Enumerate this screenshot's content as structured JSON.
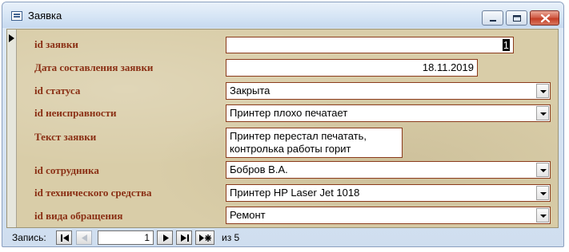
{
  "window": {
    "title": "Заявка"
  },
  "form": {
    "fields": [
      {
        "label": "id заявки",
        "value": "1"
      },
      {
        "label": "Дата составления заявки",
        "value": "18.11.2019"
      },
      {
        "label": "id статуса",
        "value": "Закрыта"
      },
      {
        "label": "id неисправности",
        "value": "Принтер плохо печатает"
      },
      {
        "label": "Текст заявки",
        "value": "Принтер перестал печатать,\nконтролька работы горит"
      },
      {
        "label": "id сотрудника",
        "value": "Бобров В.А."
      },
      {
        "label": "id технического средства",
        "value": "Принтер HP Laser Jet 1018"
      },
      {
        "label": "id вида обращения",
        "value": "Ремонт"
      }
    ]
  },
  "navigation": {
    "label": "Запись:",
    "current": "1",
    "of_text": "из  5",
    "buttons": [
      "first-record-icon",
      "previous-record-icon",
      "next-record-icon",
      "last-record-icon",
      "new-record-icon"
    ]
  },
  "colors": {
    "label_text": "#8a2f14",
    "field_border": "#8b3b1c",
    "form_background": "#d9cda8"
  }
}
